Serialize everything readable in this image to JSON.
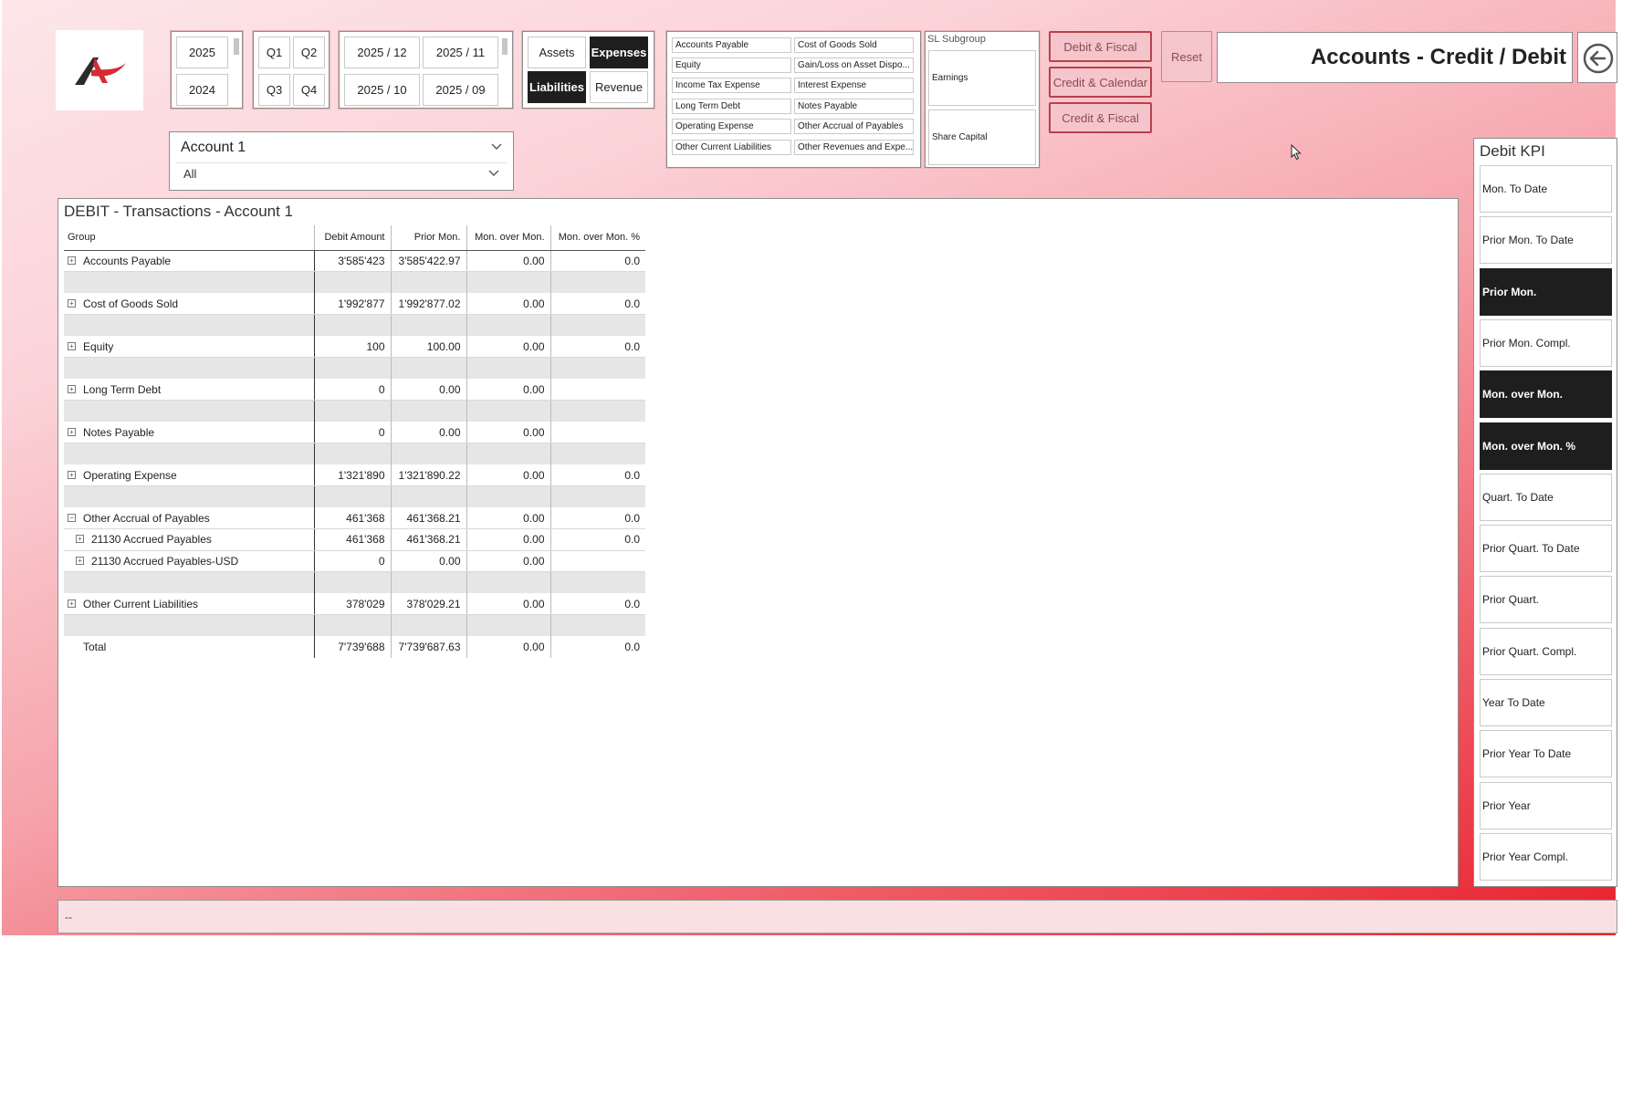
{
  "header": {
    "title": "Accounts - Credit / Debit",
    "back_icon": "arrow-left-circle-icon"
  },
  "years": [
    "2025",
    "2024"
  ],
  "quarters": [
    "Q1",
    "Q2",
    "Q3",
    "Q4"
  ],
  "months": [
    "2025 / 12",
    "2025 / 11",
    "2025 / 10",
    "2025 / 09"
  ],
  "categories": {
    "assets": "Assets",
    "expenses": "Expenses",
    "liabilities": "Liabilities",
    "revenue": "Revenue",
    "selected": [
      "Expenses",
      "Liabilities"
    ]
  },
  "groups": [
    "Accounts Payable",
    "Cost of Goods Sold",
    "Equity",
    "Gain/Loss on Asset Dispo...",
    "Income Tax Expense",
    "Interest Expense",
    "Long Term Debt",
    "Notes Payable",
    "Operating Expense",
    "Other Accrual of Payables",
    "Other Current Liabilities",
    "Other Revenues and Expe..."
  ],
  "subgroup": {
    "title": "SL Subgroup",
    "items": [
      "Earnings",
      "Share Capital"
    ]
  },
  "nav_buttons": {
    "debit_fiscal": "Debit & Fiscal",
    "credit_calendar": "Credit & Calendar",
    "credit_fiscal": "Credit & Fiscal",
    "reset": "Reset"
  },
  "account_filter": {
    "title": "Account 1",
    "value": "All"
  },
  "table": {
    "title": "DEBIT - Transactions - Account 1",
    "columns": [
      "Group",
      "Debit Amount",
      "Prior Mon.",
      "Mon. over Mon.",
      "Mon. over Mon. %"
    ],
    "rows": [
      {
        "group": "Accounts Payable",
        "level": 0,
        "expand": "+",
        "debit": "3'585'423",
        "prior": "3'585'422.97",
        "mom": "0.00",
        "mom_pct": "0.0",
        "spacer_after": true
      },
      {
        "group": "Cost of Goods Sold",
        "level": 0,
        "expand": "+",
        "debit": "1'992'877",
        "prior": "1'992'877.02",
        "mom": "0.00",
        "mom_pct": "0.0",
        "spacer_after": true
      },
      {
        "group": "Equity",
        "level": 0,
        "expand": "+",
        "debit": "100",
        "prior": "100.00",
        "mom": "0.00",
        "mom_pct": "0.0",
        "spacer_after": true
      },
      {
        "group": "Long Term Debt",
        "level": 0,
        "expand": "+",
        "debit": "0",
        "prior": "0.00",
        "mom": "0.00",
        "mom_pct": "",
        "spacer_after": true
      },
      {
        "group": "Notes Payable",
        "level": 0,
        "expand": "+",
        "debit": "0",
        "prior": "0.00",
        "mom": "0.00",
        "mom_pct": "",
        "spacer_after": true
      },
      {
        "group": "Operating Expense",
        "level": 0,
        "expand": "+",
        "debit": "1'321'890",
        "prior": "1'321'890.22",
        "mom": "0.00",
        "mom_pct": "0.0",
        "spacer_after": true
      },
      {
        "group": "Other Accrual of Payables",
        "level": 0,
        "expand": "-",
        "debit": "461'368",
        "prior": "461'368.21",
        "mom": "0.00",
        "mom_pct": "0.0",
        "spacer_after": false
      },
      {
        "group": "21130 Accrued Payables",
        "level": 1,
        "expand": "+",
        "debit": "461'368",
        "prior": "461'368.21",
        "mom": "0.00",
        "mom_pct": "0.0",
        "spacer_after": false
      },
      {
        "group": "21130 Accrued Payables-USD",
        "level": 1,
        "expand": "+",
        "debit": "0",
        "prior": "0.00",
        "mom": "0.00",
        "mom_pct": "",
        "spacer_after": true
      },
      {
        "group": "Other Current Liabilities",
        "level": 0,
        "expand": "+",
        "debit": "378'029",
        "prior": "378'029.21",
        "mom": "0.00",
        "mom_pct": "0.0",
        "spacer_after": true
      }
    ],
    "total": {
      "group": "Total",
      "debit": "7'739'688",
      "prior": "7'739'687.63",
      "mom": "0.00",
      "mom_pct": "0.0"
    }
  },
  "kpi": {
    "title": "Debit KPI",
    "items": [
      {
        "label": "Mon. To Date",
        "selected": false
      },
      {
        "label": "Prior Mon. To Date",
        "selected": false
      },
      {
        "label": "Prior Mon.",
        "selected": true
      },
      {
        "label": "Prior Mon. Compl.",
        "selected": false
      },
      {
        "label": "Mon. over Mon.",
        "selected": true
      },
      {
        "label": "Mon. over Mon. %",
        "selected": true
      },
      {
        "label": "Quart. To Date",
        "selected": false
      },
      {
        "label": "Prior Quart. To Date",
        "selected": false
      },
      {
        "label": "Prior Quart.",
        "selected": false
      },
      {
        "label": "Prior Quart. Compl.",
        "selected": false
      },
      {
        "label": "Year To Date",
        "selected": false
      },
      {
        "label": "Prior Year To Date",
        "selected": false
      },
      {
        "label": "Prior Year",
        "selected": false
      },
      {
        "label": "Prior Year Compl.",
        "selected": false
      }
    ]
  },
  "status": "--",
  "colors": {
    "accent_dark": "#1e1e1e",
    "button_pink": "#f4c6cb",
    "button_border": "#b8404c",
    "logo_red": "#d62b33"
  }
}
